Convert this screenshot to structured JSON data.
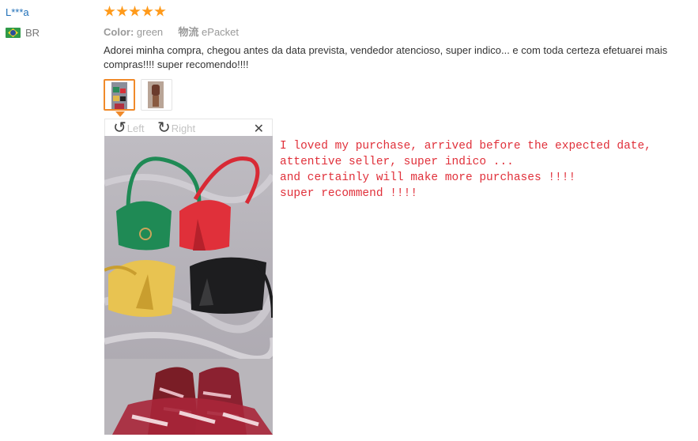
{
  "review": {
    "user": "L***a",
    "country_code": "BR",
    "rating": 5,
    "attributes": [
      {
        "key": "Color:",
        "value": "green"
      },
      {
        "key": "物流",
        "value": "ePacket"
      }
    ],
    "text": "Adorei minha compra, chegou antes da data prevista, vendedor atencioso, super indico... e com toda certeza efetuarei mais compras!!!! super recomendo!!!!",
    "photos_count": 2
  },
  "viewer": {
    "rotate_left_label": "Left",
    "rotate_right_label": "Right"
  },
  "translation": "I loved my purchase, arrived before the expected date,\nattentive seller, super indico ...\nand certainly will make more purchases !!!!\nsuper recommend !!!!",
  "icons": {
    "rotate_left": "rotate-left-icon",
    "rotate_right": "rotate-right-icon",
    "close": "close-icon",
    "star": "star-icon",
    "flag": "brazil-flag-icon"
  },
  "colors": {
    "user_name": "#1f6fb8",
    "star": "#ff9a1a",
    "active_thumb_border": "#f08a2a",
    "translation_text": "#e0303a"
  }
}
